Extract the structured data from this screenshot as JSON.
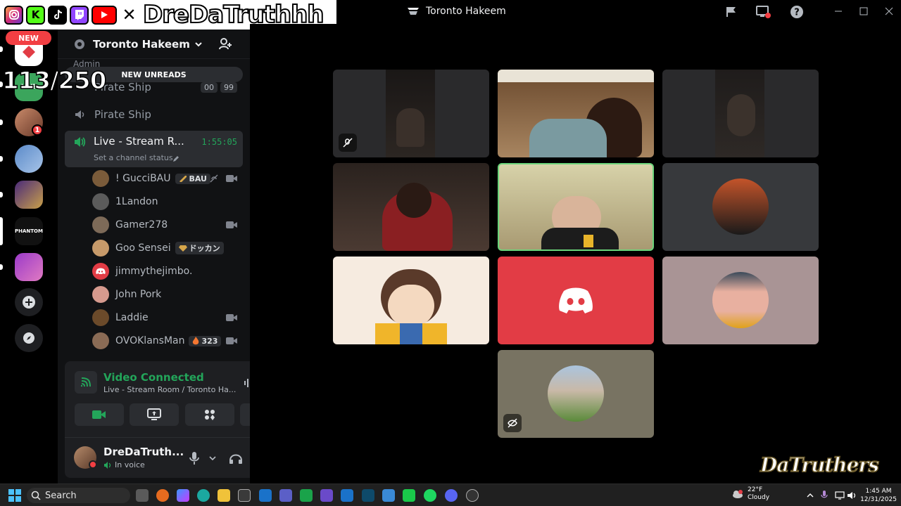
{
  "window": {
    "title": "Toronto Hakeem"
  },
  "overlay": {
    "channel_name": "DreDaTruthhh",
    "social_icons": [
      "instagram-icon",
      "kick-icon",
      "tiktok-icon",
      "twitch-icon",
      "youtube-icon",
      "x-icon"
    ],
    "counter": "113/250",
    "watermark": "DaTruthers"
  },
  "rail": {
    "new_badge": "NEW",
    "notification_count": "1"
  },
  "sidebar": {
    "server_name": "Toronto Hakeem",
    "admin_label": "Admin",
    "new_unreads": "NEW UNREADS",
    "channels": [
      {
        "name": "Pirate Ship",
        "count_a": "00",
        "count_b": "99"
      },
      {
        "name": "Pirate Ship"
      }
    ],
    "live_channel": {
      "name": "Live - Stream R...",
      "timer": "1:55:05",
      "status": "Set a channel status"
    },
    "users": [
      {
        "name": "! GucciBAU",
        "tag": "BAU",
        "color": "#7a5b3a"
      },
      {
        "name": "1Landon",
        "color": "#5b5b5b"
      },
      {
        "name": "Gamer278",
        "color": "#7d6a58"
      },
      {
        "name": "Goo Sensei",
        "tag": "ドッカン",
        "color": "#c79a6a"
      },
      {
        "name": "jimmythejimbo.",
        "color": "#e23c45"
      },
      {
        "name": "John Pork",
        "color": "#d69a8e"
      },
      {
        "name": "Laddie",
        "color": "#6b4a2a"
      },
      {
        "name": "OVOKlansMan",
        "tag": "323",
        "color": "#8a6b55"
      }
    ]
  },
  "voice": {
    "status": "Video Connected",
    "location": "Live - Stream Room / Toronto Ha..."
  },
  "user_panel": {
    "name": "DreDaTruth...",
    "status": "In voice"
  },
  "taskbar": {
    "search": "Search",
    "weather_temp": "22°F",
    "weather_desc": "Cloudy",
    "time": "1:45 AM",
    "date": "12/31/2025"
  },
  "colors": {
    "accent_green": "#23a55a",
    "discord_red": "#e23c45",
    "active_speaker": "#6ad37a"
  }
}
